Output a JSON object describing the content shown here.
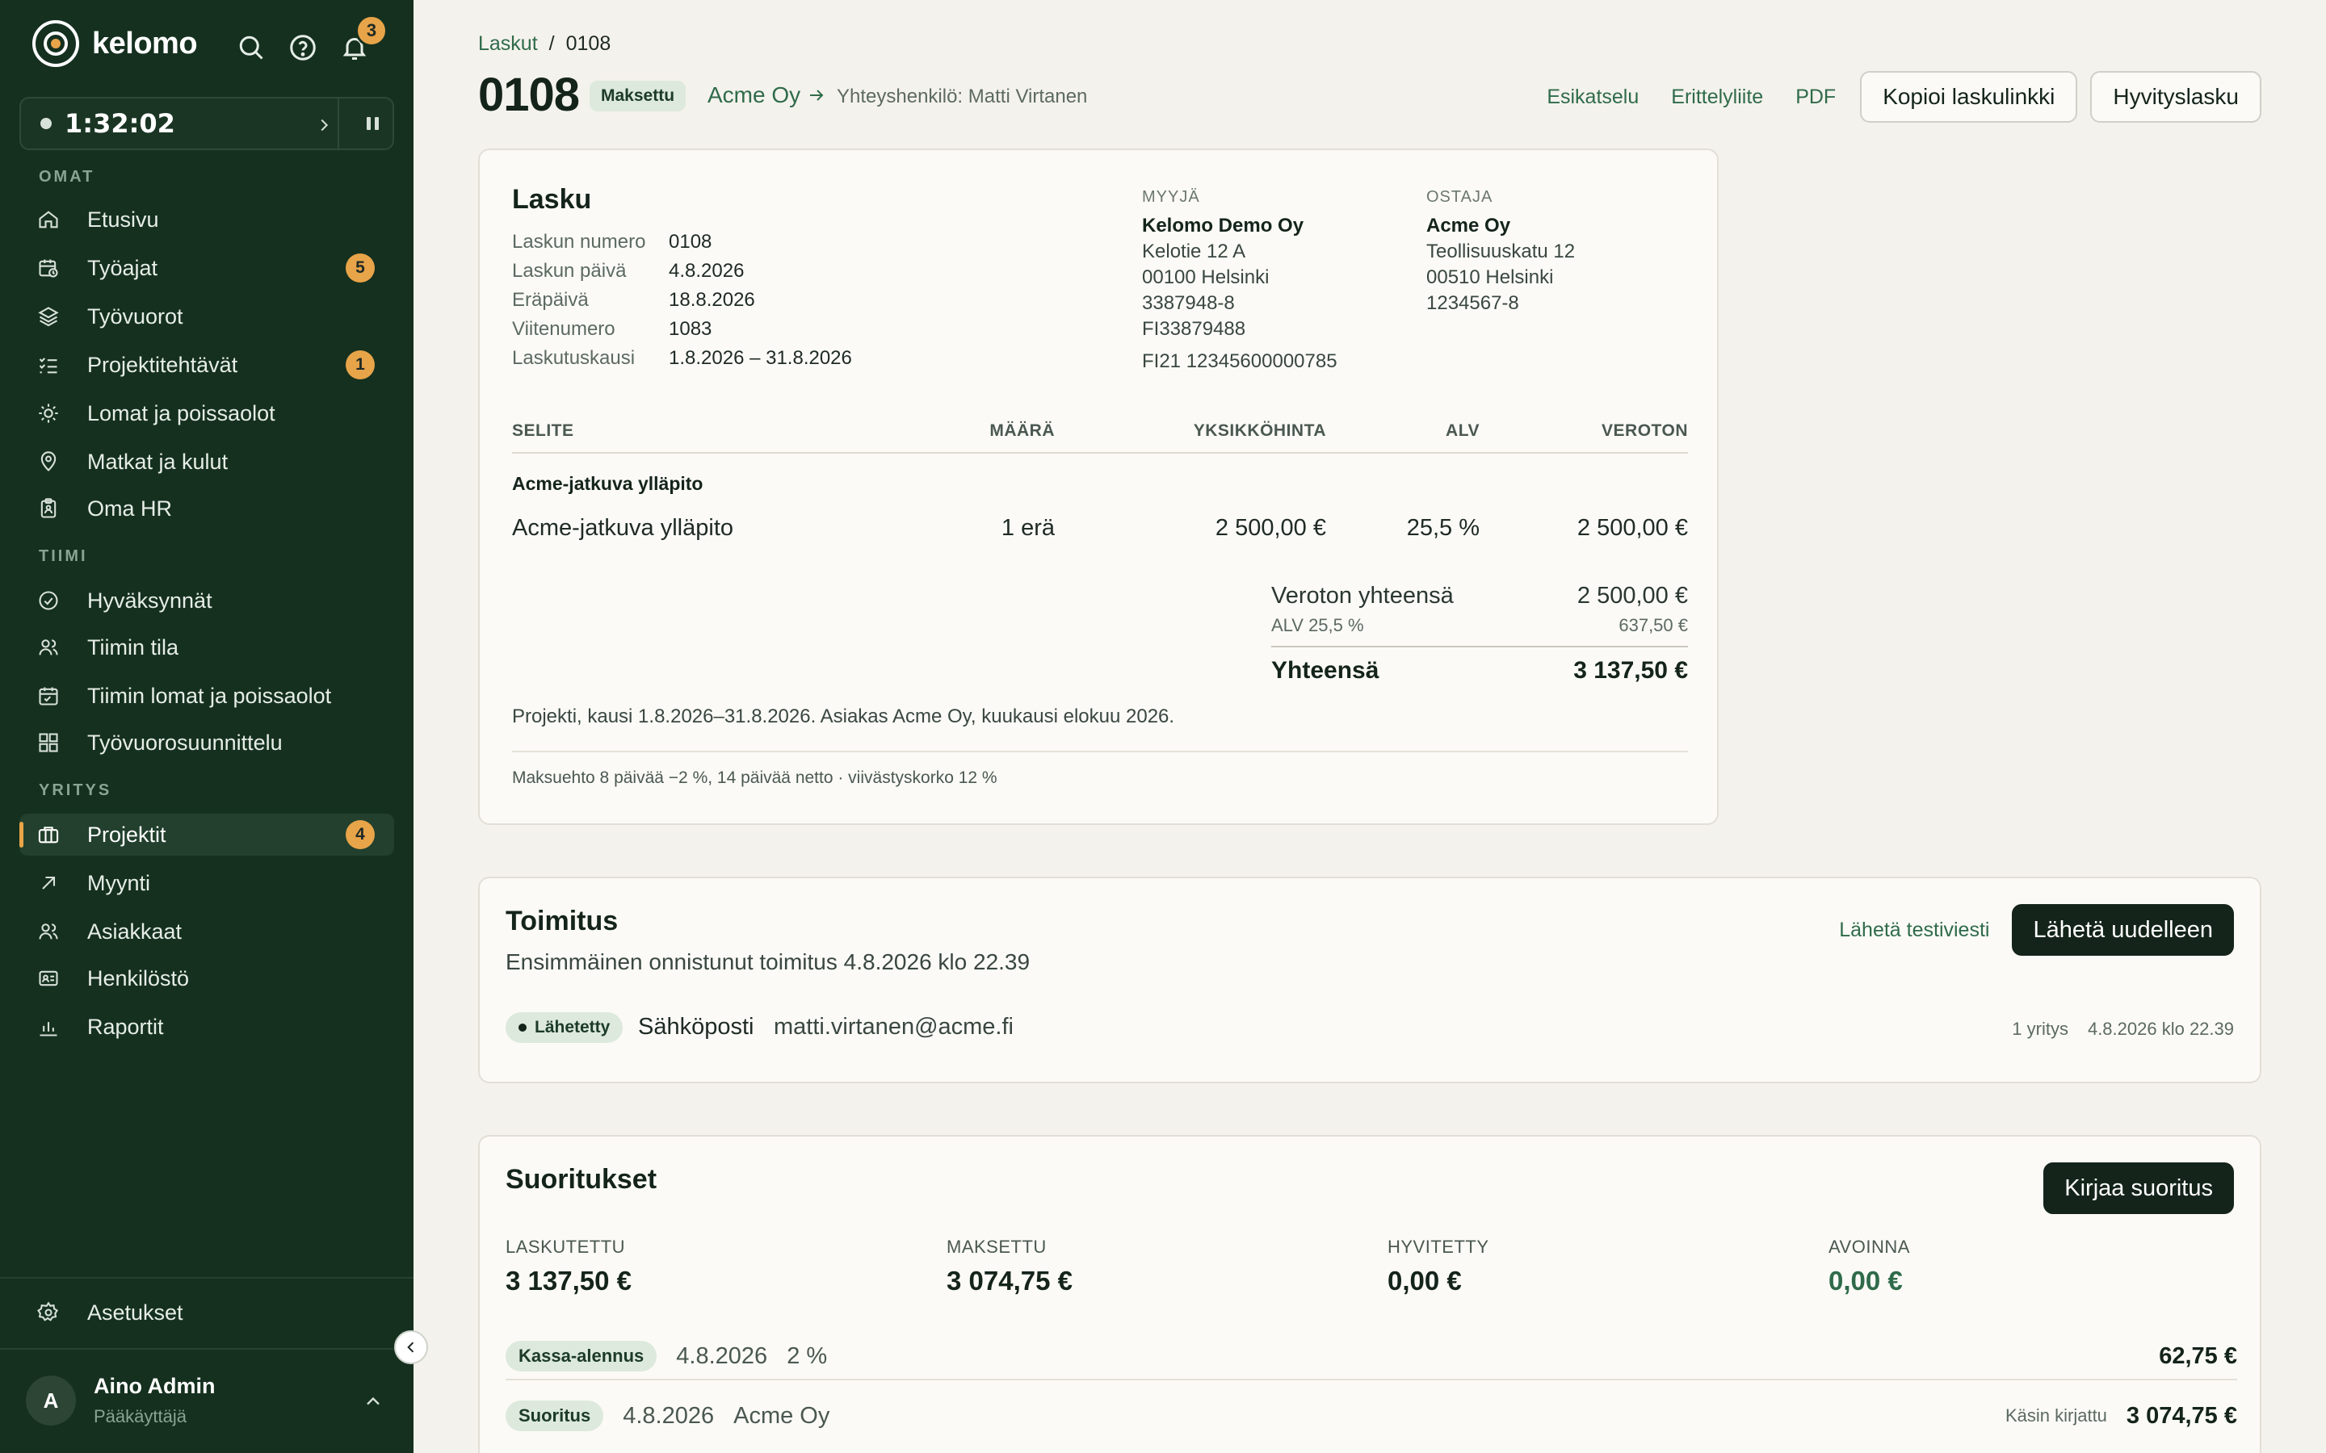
{
  "brand": {
    "name": "kelomo"
  },
  "header_icons": {
    "notifications_count": "3"
  },
  "timer": {
    "value": "1:32:02"
  },
  "sidebar": {
    "sections": [
      {
        "label": "OMAT",
        "items": [
          {
            "label": "Etusivu",
            "icon": "home-icon"
          },
          {
            "label": "Työajat",
            "icon": "calendar-clock-icon",
            "badge": "5"
          },
          {
            "label": "Työvuorot",
            "icon": "layers-icon"
          },
          {
            "label": "Projektitehtävät",
            "icon": "checklist-icon",
            "badge": "1"
          },
          {
            "label": "Lomat ja poissaolot",
            "icon": "sun-icon"
          },
          {
            "label": "Matkat ja kulut",
            "icon": "map-pin-icon"
          },
          {
            "label": "Oma HR",
            "icon": "clipboard-icon"
          }
        ]
      },
      {
        "label": "TIIMI",
        "items": [
          {
            "label": "Hyväksynnät",
            "icon": "check-circle-icon"
          },
          {
            "label": "Tiimin tila",
            "icon": "users-icon"
          },
          {
            "label": "Tiimin lomat ja poissaolot",
            "icon": "calendar-icon"
          },
          {
            "label": "Työvuorosuunnittelu",
            "icon": "grid-icon"
          }
        ]
      },
      {
        "label": "YRITYS",
        "items": [
          {
            "label": "Projektit",
            "icon": "briefcase-icon",
            "badge": "4",
            "active": true
          },
          {
            "label": "Myynti",
            "icon": "arrow-up-right-icon"
          },
          {
            "label": "Asiakkaat",
            "icon": "users-icon"
          },
          {
            "label": "Henkilöstö",
            "icon": "id-card-icon"
          },
          {
            "label": "Raportit",
            "icon": "bar-chart-icon"
          }
        ]
      }
    ],
    "settings_label": "Asetukset",
    "user": {
      "initial": "A",
      "name": "Aino Admin",
      "role": "Pääkäyttäjä"
    }
  },
  "breadcrumb": {
    "parent": "Laskut",
    "separator": "/",
    "current": "0108"
  },
  "page": {
    "title": "0108",
    "status": "Maksettu",
    "client": "Acme Oy",
    "contact": "Yhteyshenkilö: Matti Virtanen",
    "links": [
      "Esikatselu",
      "Erittelyliite",
      "PDF"
    ],
    "buttons": [
      "Kopioi laskulinkki",
      "Hyvityslasku"
    ]
  },
  "invoice": {
    "title": "Lasku",
    "meta": [
      {
        "k": "Laskun numero",
        "v": "0108"
      },
      {
        "k": "Laskun päivä",
        "v": "4.8.2026"
      },
      {
        "k": "Eräpäivä",
        "v": "18.8.2026"
      },
      {
        "k": "Viitenumero",
        "v": "1083"
      },
      {
        "k": "Laskutuskausi",
        "v": "1.8.2026 – 31.8.2026"
      }
    ],
    "seller": {
      "heading": "MYYJÄ",
      "name": "Kelomo Demo Oy",
      "lines": [
        "Kelotie 12 A",
        "00100 Helsinki",
        "3387948-8",
        "FI33879488"
      ],
      "iban": "FI21 12345600000785"
    },
    "buyer": {
      "heading": "OSTAJA",
      "name": "Acme Oy",
      "lines": [
        "Teollisuuskatu 12",
        "00510 Helsinki",
        "1234567-8"
      ]
    },
    "columns": {
      "desc": "SELITE",
      "qty": "MÄÄRÄ",
      "unit": "YKSIKKÖHINTA",
      "vat": "ALV",
      "net": "VEROTON"
    },
    "group_title": "Acme-jatkuva ylläpito",
    "row": {
      "desc": "Acme-jatkuva ylläpito",
      "qty": "1 erä",
      "unit": "2 500,00 €",
      "vat": "25,5 %",
      "net": "2 500,00 €"
    },
    "totals": {
      "net_label": "Veroton yhteensä",
      "net_value": "2 500,00 €",
      "vat_label": "ALV 25,5 %",
      "vat_value": "637,50 €",
      "total_label": "Yhteensä",
      "total_value": "3 137,50 €"
    },
    "note": "Projekti, kausi 1.8.2026–31.8.2026. Asiakas Acme Oy, kuukausi elokuu 2026.",
    "terms": "Maksuehto 8 päivää −2 %, 14 päivää netto · viivästyskorko 12 %"
  },
  "delivery": {
    "title": "Toimitus",
    "subtitle": "Ensimmäinen onnistunut toimitus 4.8.2026 klo 22.39",
    "test_link": "Lähetä testiviesti",
    "resend_button": "Lähetä uudelleen",
    "status": "Lähetetty",
    "channel": "Sähköposti",
    "email": "matti.virtanen@acme.fi",
    "attempts": "1 yritys",
    "timestamp": "4.8.2026 klo 22.39"
  },
  "payments": {
    "title": "Suoritukset",
    "button": "Kirjaa suoritus",
    "stats": [
      {
        "label": "LASKUTETTU",
        "value": "3 137,50 €"
      },
      {
        "label": "MAKSETTU",
        "value": "3 074,75 €"
      },
      {
        "label": "HYVITETTY",
        "value": "0,00 €"
      },
      {
        "label": "AVOINNA",
        "value": "0,00 €"
      }
    ],
    "rows": [
      {
        "type": "Kassa-alennus",
        "date": "4.8.2026",
        "extra": "2 %",
        "note": "",
        "amount": "62,75 €"
      },
      {
        "type": "Suoritus",
        "date": "4.8.2026",
        "extra": "Acme Oy",
        "note": "Käsin kirjattu",
        "amount": "3 074,75 €"
      }
    ]
  },
  "colors": {
    "sidebar_bg": "#15301f",
    "accent": "#e8a449",
    "link": "#2f6b4a",
    "page_bg": "#f4f2ec",
    "primary_button": "#14241a"
  }
}
